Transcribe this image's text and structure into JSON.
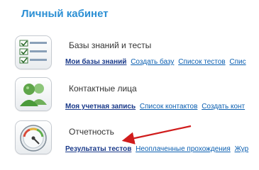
{
  "page": {
    "title": "Личный кабинет"
  },
  "sections": [
    {
      "title": "Базы знаний и тесты",
      "icon": "checklist-icon",
      "links": [
        "Мои базы знаний",
        "Создать базу",
        "Список тестов",
        "Спис"
      ]
    },
    {
      "title": "Контактные лица",
      "icon": "contacts-people-icon",
      "links": [
        "Моя учетная запись",
        "Список контактов",
        "Создать конт"
      ]
    },
    {
      "title": "Отчетность",
      "icon": "gauge-icon",
      "links": [
        "Результаты тестов",
        "Неоплаченные прохождения",
        "Жур"
      ]
    }
  ],
  "colors": {
    "heading": "#2b8fd4",
    "link": "#0b5fb1",
    "arrow": "#d01c1c"
  }
}
